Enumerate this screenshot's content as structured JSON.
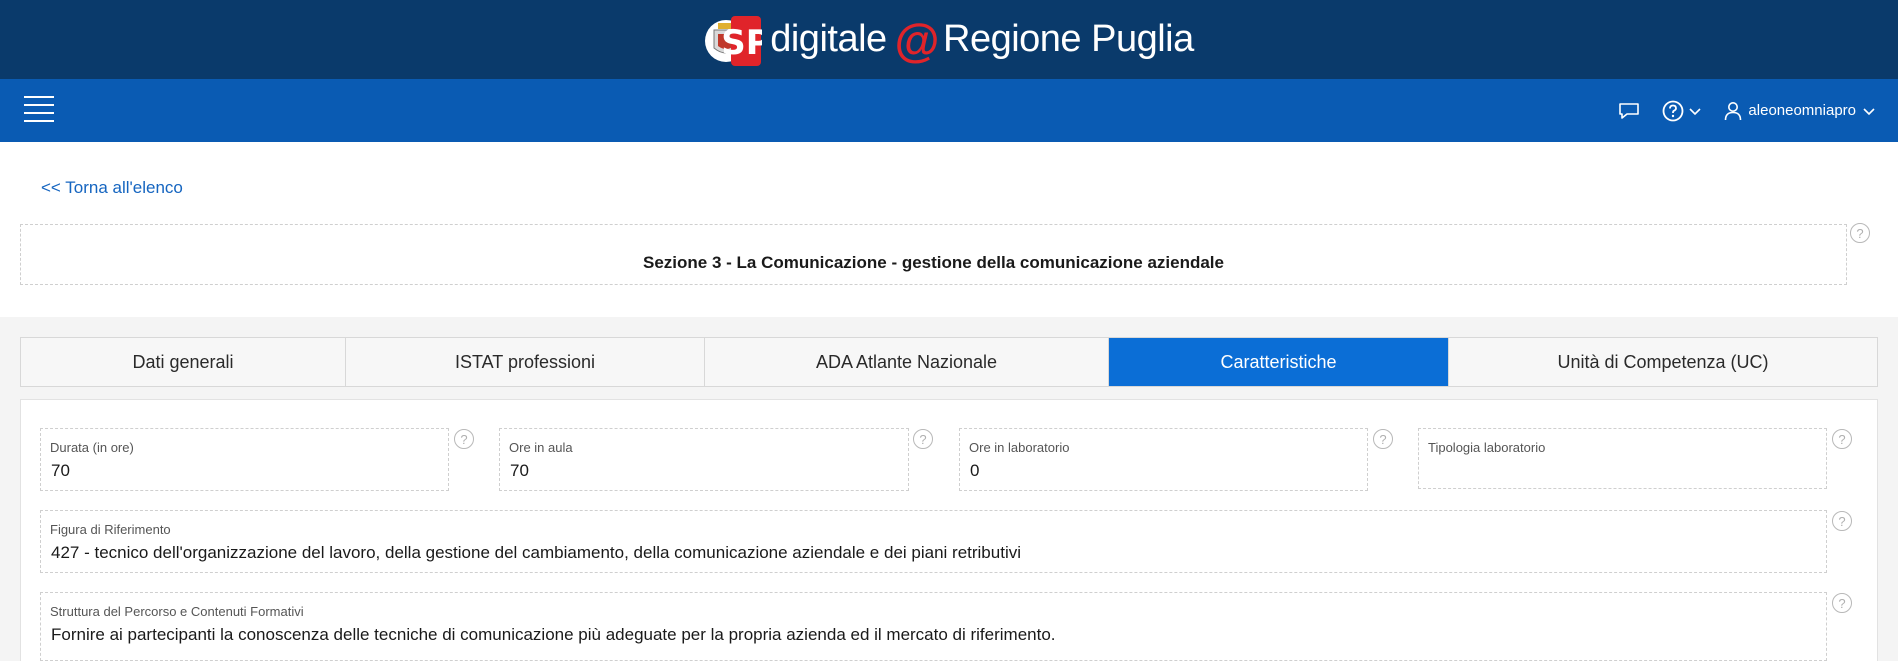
{
  "brand": {
    "logo_text": "SP",
    "name_part1": "digitale",
    "at_symbol": "@",
    "name_part2": "Regione Puglia",
    "bg_color": "#0a3a6b",
    "accent_color": "#e0242a"
  },
  "nav": {
    "menu_icon": "hamburger-icon",
    "chat_icon": "chat-icon",
    "help_icon": "help-circle-icon",
    "user_icon": "user-icon",
    "username": "aleoneomniapro",
    "bg_color": "#0a5bb3"
  },
  "back_link": "<< Torna all'elenco",
  "section": {
    "title": "Sezione 3 - La Comunicazione - gestione della comunicazione aziendale",
    "help": "?"
  },
  "tabs": [
    {
      "label": "Dati generali",
      "active": false
    },
    {
      "label": "ISTAT professioni",
      "active": false
    },
    {
      "label": "ADA Atlante Nazionale",
      "active": false
    },
    {
      "label": "Caratteristiche",
      "active": true
    },
    {
      "label": "Unità di Competenza (UC)",
      "active": false
    }
  ],
  "fields": {
    "durata": {
      "label": "Durata (in ore)",
      "value": "70",
      "help": "?"
    },
    "ore_aula": {
      "label": "Ore in aula",
      "value": "70",
      "help": "?"
    },
    "ore_lab": {
      "label": "Ore in laboratorio",
      "value": "0",
      "help": "?"
    },
    "tipologia_lab": {
      "label": "Tipologia laboratorio",
      "value": "",
      "help": "?"
    },
    "figura": {
      "label": "Figura di Riferimento",
      "value": "427 - tecnico dell'organizzazione del lavoro, della gestione del cambiamento, della comunicazione aziendale e dei piani retributivi",
      "help": "?"
    },
    "struttura": {
      "label": "Struttura del Percorso e Contenuti Formativi",
      "value": "Fornire ai partecipanti la conoscenza delle tecniche di comunicazione più adeguate per la propria azienda ed il mercato di riferimento.",
      "help": "?"
    }
  }
}
